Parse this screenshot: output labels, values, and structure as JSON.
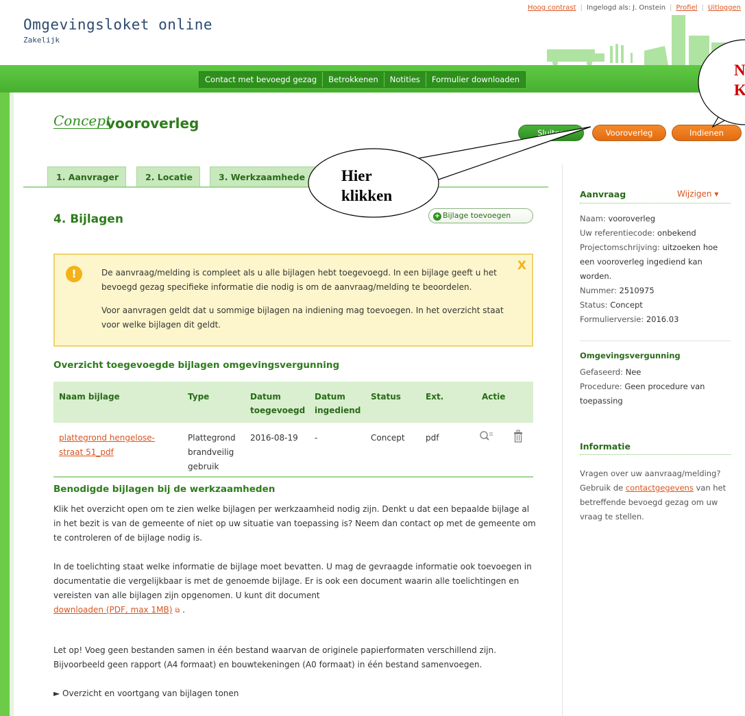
{
  "header": {
    "app_title": "Omgevingsloket online",
    "app_subtitle": "Zakelijk",
    "links": {
      "high_contrast": "Hoog contrast",
      "logged_in_as": "Ingelogd als: J. Onstein",
      "profile": "Profiel",
      "logout": "Uitloggen"
    }
  },
  "nav": {
    "tabs": [
      "Contact met bevoegd gezag",
      "Betrokkenen",
      "Notities",
      "Formulier downloaden"
    ]
  },
  "page": {
    "status": "Concept",
    "title": "vooroverleg",
    "buttons": {
      "close": "Sluiten",
      "preconsult": "Vooroverleg",
      "submit": "Indienen"
    }
  },
  "steps": [
    "1. Aanvrager",
    "2. Locatie",
    "3. Werkzaamhede"
  ],
  "section": {
    "title": "4. Bijlagen",
    "add_button": "Bijlage toevoegen"
  },
  "warning": {
    "icon": "!",
    "close": "X",
    "p1": "De aanvraag/melding is compleet als u alle bijlagen hebt toegevoegd. In een bijlage geeft u het bevoegd gezag specifieke informatie die nodig is om de aanvraag/melding te beoordelen.",
    "p2": "Voor aanvragen geldt dat u sommige bijlagen na indiening mag toevoegen. In het overzicht staat voor welke bijlagen dit geldt."
  },
  "overview": {
    "title": "Overzicht toegevoegde bijlagen omgevingsvergunning",
    "headers": {
      "name": "Naam bijlage",
      "type": "Type",
      "date_added_1": "Datum",
      "date_added_2": "toegevoegd",
      "date_submitted_1": "Datum",
      "date_submitted_2": "ingediend",
      "status": "Status",
      "ext": "Ext.",
      "action": "Actie"
    },
    "rows": [
      {
        "name_1": "plattegrond hengelose-",
        "name_2": "straat 51_pdf",
        "type_1": "Plattegrond",
        "type_2": "brandveilig",
        "type_3": "gebruik",
        "date_added": "2016-08-19",
        "date_submitted": "-",
        "status": "Concept",
        "ext": "pdf"
      }
    ]
  },
  "required": {
    "title": "Benodigde bijlagen bij de werkzaamheden",
    "p1": "Klik het overzicht open om te zien welke bijlagen per werkzaamheid nodig zijn. Denkt u dat een bepaalde bijlage al in het bezit is van de gemeente of niet op uw situatie van toepassing is? Neem dan contact op met de gemeente om te controleren of de bijlage nodig is.",
    "p2": "In de toelichting staat welke informatie de bijlage moet bevatten. U mag de gevraagde informatie ook toevoegen in documentatie die vergelijkbaar is met de genoemde bijlage. Er is ook een document waarin alle toelichtingen en vereisten van alle bijlagen zijn opgenomen. U kunt dit document",
    "download_link": "downloaden (PDF, max 1MB)",
    "p3": "Let op! Voeg geen bestanden samen in één bestand waarvan de originele papierformaten verschillend zijn. Bijvoorbeeld geen rapport (A4 formaat) en bouwtekeningen (A0 formaat) in één bestand samenvoegen.",
    "toggle": "► Overzicht en voortgang van bijlagen tonen"
  },
  "sidebar": {
    "request_title": "Aanvraag",
    "edit": "Wijzigen ▾",
    "name_label": "Naam:",
    "name_value": "vooroverleg",
    "ref_label": "Uw referentiecode:",
    "ref_value": "onbekend",
    "desc_label": "Projectomschrijving:",
    "desc_value": "uitzoeken hoe een vooroverleg ingediend kan worden.",
    "number_label": "Nummer:",
    "number_value": "2510975",
    "status_label": "Status:",
    "status_value": "Concept",
    "version_label": "Formulierversie:",
    "version_value": "2016.03",
    "permit_title": "Omgevingsvergunning",
    "phased_label": "Gefaseerd:",
    "phased_value": "Nee",
    "procedure_label": "Procedure:",
    "procedure_value": "Geen procedure van toepassing",
    "info_title": "Informatie",
    "info_text_1": "Vragen over uw aanvraag/melding? Gebruik de",
    "info_link": "contactgegevens",
    "info_text_2": "van het betreffende bevoegd gezag om uw vraag te stellen."
  },
  "callouts": {
    "left_line1": "Hier",
    "left_line2": "klikken",
    "right_line1": "N",
    "right_line2": "K"
  }
}
